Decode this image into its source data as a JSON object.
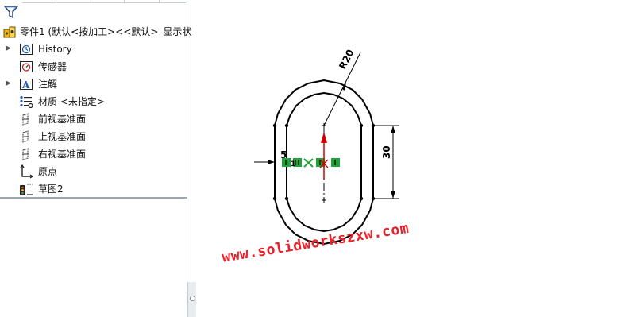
{
  "feature_tree": {
    "part_name": "零件1 (默认<按加工><<默认>_显示状",
    "items": [
      {
        "label": "History",
        "icon": "history-icon",
        "expandable": true
      },
      {
        "label": "传感器",
        "icon": "sensor-icon",
        "expandable": false
      },
      {
        "label": "注解",
        "icon": "annotation-icon",
        "expandable": true
      },
      {
        "label": "材质 <未指定>",
        "icon": "material-icon",
        "expandable": false
      },
      {
        "label": "前视基准面",
        "icon": "plane-icon",
        "expandable": false
      },
      {
        "label": "上视基准面",
        "icon": "plane-icon",
        "expandable": false
      },
      {
        "label": "右视基准面",
        "icon": "plane-icon",
        "expandable": false
      },
      {
        "label": "原点",
        "icon": "origin-icon",
        "expandable": false
      },
      {
        "label": "草图2",
        "icon": "sketch-icon",
        "expandable": false
      }
    ]
  },
  "sketch": {
    "radius_dim": "R20",
    "height_dim": "30",
    "offset_dim": "5",
    "relation_label": "1",
    "line_color": "#000000",
    "arrow_color": "#cc0000",
    "relation_color": "#22a33a"
  },
  "watermark": "www.solidworkszxw.com",
  "colors": {
    "watermark": "#e8202a",
    "panel_border": "#a9b3bf"
  }
}
